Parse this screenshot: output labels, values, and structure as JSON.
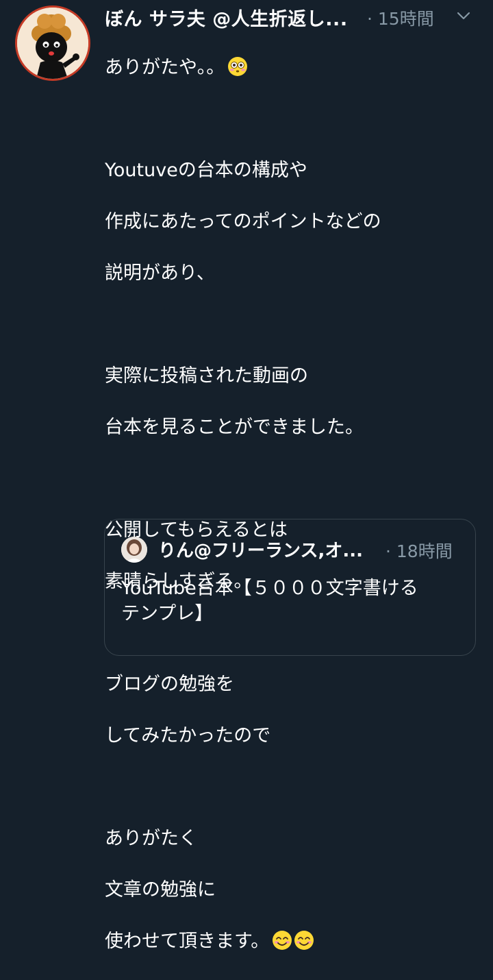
{
  "tweet": {
    "display_name": "ぼん サラ夫 @人生折返し...",
    "separator": "·",
    "time": "15時間",
    "menu_icon": "chevron-down-icon",
    "avatar_icon": "cartoon-avatar",
    "body_lines": [
      "ありがたや。。",
      "",
      "Youtuveの台本の構成や",
      "作成にあたってのポイントなどの",
      "説明があり、",
      "",
      "実際に投稿された動画の",
      "台本を見ることができました。",
      "",
      "公開してもらえるとは",
      "素晴らしすぎる。",
      "",
      "ブログの勉強を",
      "してみたかったので",
      "",
      "ありがたく",
      "文章の勉強に",
      "使わせて頂きます。"
    ],
    "emojis": {
      "line_0": "flushed-face-emoji",
      "last_line": [
        "smiling-face-emoji",
        "smiling-face-emoji"
      ]
    }
  },
  "quoted_tweet": {
    "display_name": "りん@フリーランス,オ...",
    "separator": "·",
    "time": "18時間",
    "avatar_icon": "profile-photo",
    "text_line1": "YouTube台本【５０００文字書ける",
    "text_line2": "テンプレ】"
  },
  "colors": {
    "background": "#15202b",
    "text": "#ffffff",
    "muted": "#8899a6",
    "border": "#38444d"
  }
}
